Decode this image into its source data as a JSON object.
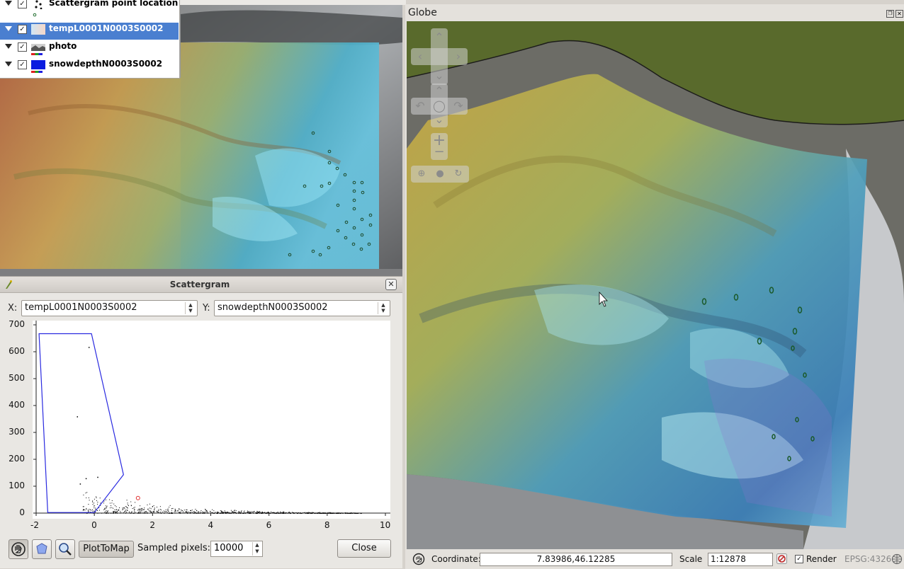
{
  "layers": [
    {
      "label": "Scattergram point location",
      "checked": true,
      "selected": false,
      "icon": "points-icon"
    },
    {
      "label": "tempL0001N0003S0002",
      "checked": true,
      "selected": true,
      "icon": "raster-gradient-icon"
    },
    {
      "label": "photo",
      "checked": true,
      "selected": false,
      "icon": "photo-raster-icon"
    },
    {
      "label": "snowdepthN0003S0002",
      "checked": true,
      "selected": false,
      "icon": "blue-raster-icon"
    }
  ],
  "scattergram": {
    "title": "Scattergram",
    "x_label": "X:",
    "x_layer": "tempL0001N0003S0002",
    "y_label": "Y:",
    "y_layer": "snowdepthN0003S0002",
    "plot_to_map": "PlotToMap",
    "sampled_label": "Sampled pixels:",
    "sampled_value": "10000",
    "close": "Close"
  },
  "chart_data": {
    "type": "scatter",
    "title": "",
    "xlabel": "",
    "ylabel": "",
    "xlim": [
      -2,
      10
    ],
    "ylim": [
      0,
      700
    ],
    "x_ticks": [
      "-2",
      "0",
      "2",
      "4",
      "6",
      "8",
      "10"
    ],
    "y_ticks": [
      "0",
      "100",
      "200",
      "300",
      "400",
      "500",
      "600",
      "700"
    ],
    "selection_polygon": [
      [
        -1.9,
        667
      ],
      [
        -0.1,
        667
      ],
      [
        1.0,
        143
      ],
      [
        0.0,
        2
      ],
      [
        -1.6,
        2
      ]
    ],
    "points_color": "#000000",
    "polygon_color": "#2a2ae0",
    "marker_color": "#e03030",
    "marker": [
      1.5,
      56
    ],
    "outliers": [
      [
        -0.2,
        618
      ],
      [
        -0.6,
        360
      ],
      [
        -0.3,
        130
      ],
      [
        0.1,
        135
      ],
      [
        -0.5,
        110
      ]
    ]
  },
  "globe": {
    "title": "Globe",
    "coordinate_label": "Coordinate:",
    "coordinate_value": "7.83986,46.12285",
    "scale_label": "Scale",
    "scale_value": "1:12878",
    "render_label": "Render",
    "render_checked": true,
    "crs": "EPSG:4326"
  },
  "colors": {
    "selection": "#4a7fd0",
    "snow_blue": "#3aa8e0",
    "terrain_yellow": "#c9a84a"
  }
}
